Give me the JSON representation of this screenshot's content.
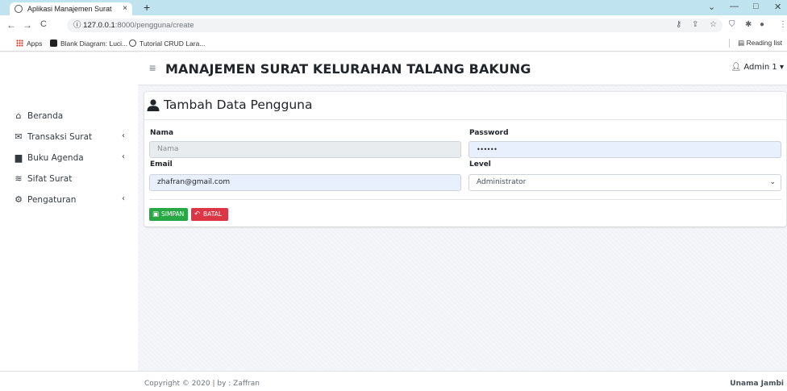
{
  "browser": {
    "tab_title": "Aplikasi Manajemen Surat",
    "tab_close": "×",
    "new_tab": "+",
    "url_host": "127.0.0.1",
    "url_path": ":8000/pengguna/create",
    "info_icon": "ⓘ",
    "bookmarks": {
      "apps": "Apps",
      "item1": "Blank Diagram: Luci...",
      "item2": "Tutorial CRUD Lara...",
      "reading_list": "Reading list"
    }
  },
  "app": {
    "title": "MANAJEMEN SURAT KELURAHAN TALANG BAKUNG",
    "user_name": "Admin 1"
  },
  "sidebar": {
    "items": [
      {
        "label": "Beranda",
        "icon": "home-icon"
      },
      {
        "label": "Transaksi Surat",
        "icon": "mail-bulk-icon",
        "has_children": true
      },
      {
        "label": "Buku Agenda",
        "icon": "book-icon",
        "has_children": true
      },
      {
        "label": "Sifat Surat",
        "icon": "layer-group-icon"
      },
      {
        "label": "Pengaturan",
        "icon": "cogs-icon",
        "has_children": true
      }
    ],
    "chevron": "‹"
  },
  "form": {
    "title": "Tambah Data Pengguna",
    "nama_label": "Nama",
    "nama_placeholder": "Nama",
    "password_label": "Password",
    "password_value": "••••••",
    "email_label": "Email",
    "email_value": "zhafran@gmail.com",
    "level_label": "Level",
    "level_value": "Administrator",
    "save_label": "SIMPAN",
    "cancel_label": "BATAL"
  },
  "footer": {
    "copyright": "Copyright © 2020 | by : Zaffran",
    "right_text": "Unama Jambi"
  },
  "colors": {
    "save": "#28a745",
    "cancel": "#dc3545",
    "autofill": "#e8f0fe"
  }
}
